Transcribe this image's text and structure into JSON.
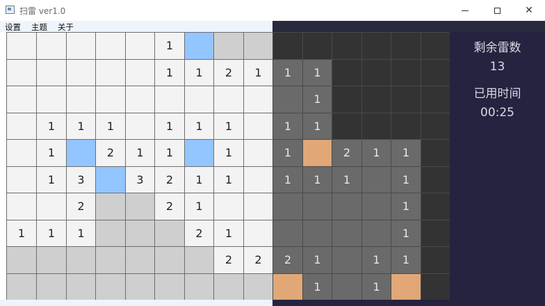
{
  "window": {
    "title": "扫雷 ver1.0",
    "minimize": "—",
    "maximize": "☐",
    "close": "✕"
  },
  "menu": [
    "设置",
    "主题",
    "关于"
  ],
  "board": {
    "rows": [
      [
        ".",
        ".",
        ".",
        ".",
        ".",
        "1",
        "h",
        "c",
        "c",
        "c",
        "c",
        "c",
        "c",
        "c",
        "c"
      ],
      [
        ".",
        ".",
        ".",
        ".",
        ".",
        "1",
        "1",
        "2",
        "1",
        "1",
        "1",
        "c",
        "c",
        "c",
        "c"
      ],
      [
        ".",
        ".",
        ".",
        ".",
        ".",
        ".",
        ".",
        ".",
        ".",
        ".",
        "1",
        "c",
        "c",
        "c",
        "c"
      ],
      [
        ".",
        "1",
        "1",
        "1",
        ".",
        "1",
        "1",
        "1",
        ".",
        "1",
        "1",
        "c",
        "c",
        "c",
        "c"
      ],
      [
        ".",
        "1",
        "h",
        "2",
        "1",
        "1",
        "h",
        "1",
        ".",
        "1",
        "h",
        "2",
        "1",
        "1",
        "c"
      ],
      [
        ".",
        "1",
        "3",
        "h",
        "3",
        "2",
        "1",
        "1",
        ".",
        "1",
        "1",
        "1",
        ".",
        "1",
        "c"
      ],
      [
        ".",
        ".",
        "2",
        "c",
        "c",
        "2",
        "1",
        ".",
        ".",
        ".",
        ".",
        ".",
        ".",
        "1",
        "c"
      ],
      [
        "1",
        "1",
        "1",
        "c",
        "c",
        "c",
        "2",
        "1",
        ".",
        ".",
        ".",
        ".",
        ".",
        "1",
        "c"
      ],
      [
        "c",
        "c",
        "c",
        "c",
        "c",
        "c",
        "c",
        "2",
        "2",
        "2",
        "1",
        ".",
        "1",
        "1",
        "c"
      ],
      [
        "c",
        "c",
        "c",
        "c",
        "c",
        "c",
        "c",
        "c",
        "c",
        "h",
        "1",
        ".",
        "1",
        "h",
        "c"
      ]
    ],
    "colors": {
      "light_open": "#f3f3f3",
      "light_covered": "#cfcfcf",
      "light_highlight": "#93c5ff",
      "dark_open": "#6a6a6a",
      "dark_covered": "#333333",
      "dark_highlight": "#e1a777"
    }
  },
  "info": {
    "mines_label": "剩余雷数",
    "mines_value": "13",
    "time_label": "已用时间",
    "time_value": "00:25"
  }
}
